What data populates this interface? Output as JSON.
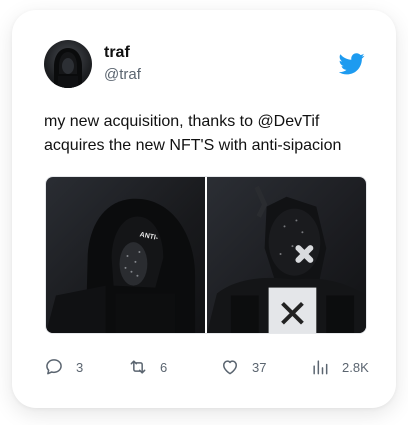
{
  "user": {
    "name": "traf",
    "handle": "@traf",
    "avatar_icon": "hooded-figure-avatar"
  },
  "tweet": {
    "text": "my new acquisition, thanks to @DevTif\nacquires the new NFT'S with anti-sipacion"
  },
  "media": [
    {
      "icon": "nft-hooded-figure-image",
      "caption": "ANTI-"
    },
    {
      "icon": "nft-robot-figure-image"
    }
  ],
  "actions": {
    "reply_count": "3",
    "retweet_count": "6",
    "like_count": "37",
    "views_count": "2.8K"
  },
  "colors": {
    "twitter_blue": "#1d9bf0",
    "text": "#111111",
    "muted": "#5b6570"
  }
}
